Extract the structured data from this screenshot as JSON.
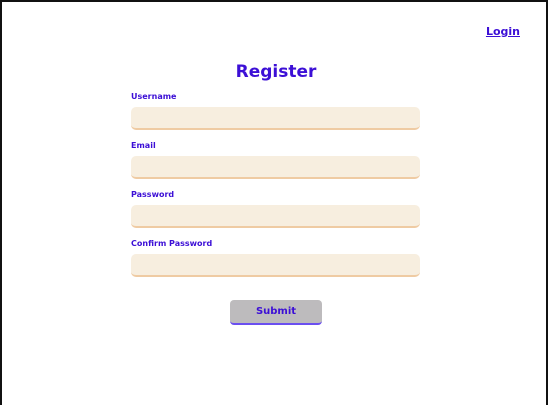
{
  "header": {
    "login_link": "Login"
  },
  "form": {
    "title": "Register",
    "fields": [
      {
        "label": "Username",
        "value": "",
        "placeholder": ""
      },
      {
        "label": "Email",
        "value": "",
        "placeholder": ""
      },
      {
        "label": "Password",
        "value": "",
        "placeholder": ""
      },
      {
        "label": "Confirm Password",
        "value": "",
        "placeholder": ""
      }
    ],
    "submit_label": "Submit"
  },
  "colors": {
    "accent": "#3c0fd6",
    "input_bg": "#f7eedf",
    "input_border": "#efcba3",
    "button_bg": "#bdbbbd",
    "button_border": "#6b4ff0"
  }
}
